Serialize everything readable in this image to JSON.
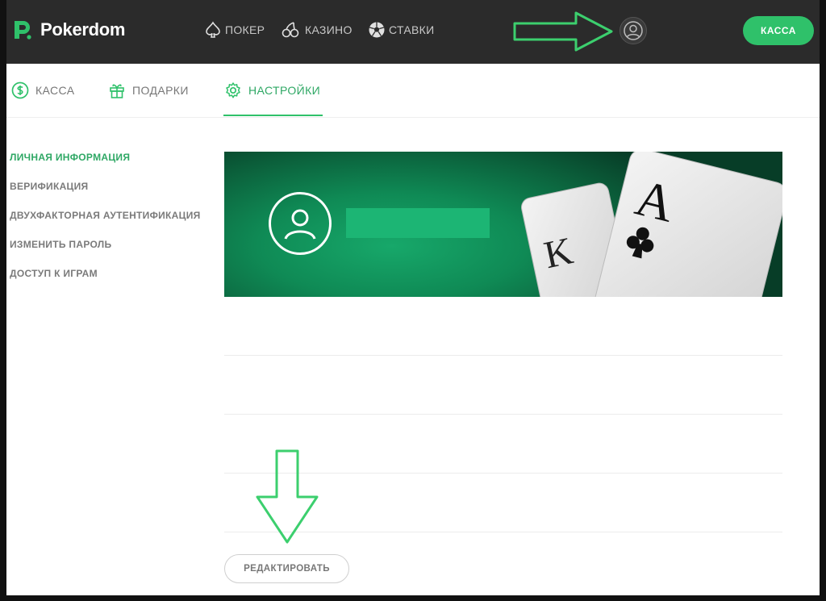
{
  "header": {
    "logo_text": "Pokerdom",
    "nav": [
      {
        "label": "ПОКЕР",
        "icon": "spade-icon"
      },
      {
        "label": "КАЗИНО",
        "icon": "cherries-icon"
      },
      {
        "label": "СТАВКИ",
        "icon": "soccer-ball-icon"
      }
    ],
    "cashier_label": "КАССА"
  },
  "tabs": [
    {
      "label": "КАССА",
      "icon": "dollar-icon",
      "active": false
    },
    {
      "label": "ПОДАРКИ",
      "icon": "gift-icon",
      "active": false
    },
    {
      "label": "НАСТРОЙКИ",
      "icon": "gear-icon",
      "active": true
    }
  ],
  "side_menu": [
    {
      "label": "ЛИЧНАЯ ИНФОРМАЦИЯ",
      "active": true
    },
    {
      "label": "ВЕРИФИКАЦИЯ",
      "active": false
    },
    {
      "label": "ДВУХФАКТОРНАЯ АУТЕНТИФИКАЦИЯ",
      "active": false
    },
    {
      "label": "ИЗМЕНИТЬ ПАРОЛЬ",
      "active": false
    },
    {
      "label": "ДОСТУП К ИГРАМ",
      "active": false
    }
  ],
  "profile": {
    "edit_label": "РЕДАКТИРОВАТЬ"
  },
  "colors": {
    "accent": "#2fc16a",
    "topbar": "#2b2b2b",
    "annotation_arrow": "#3ccf6e"
  }
}
